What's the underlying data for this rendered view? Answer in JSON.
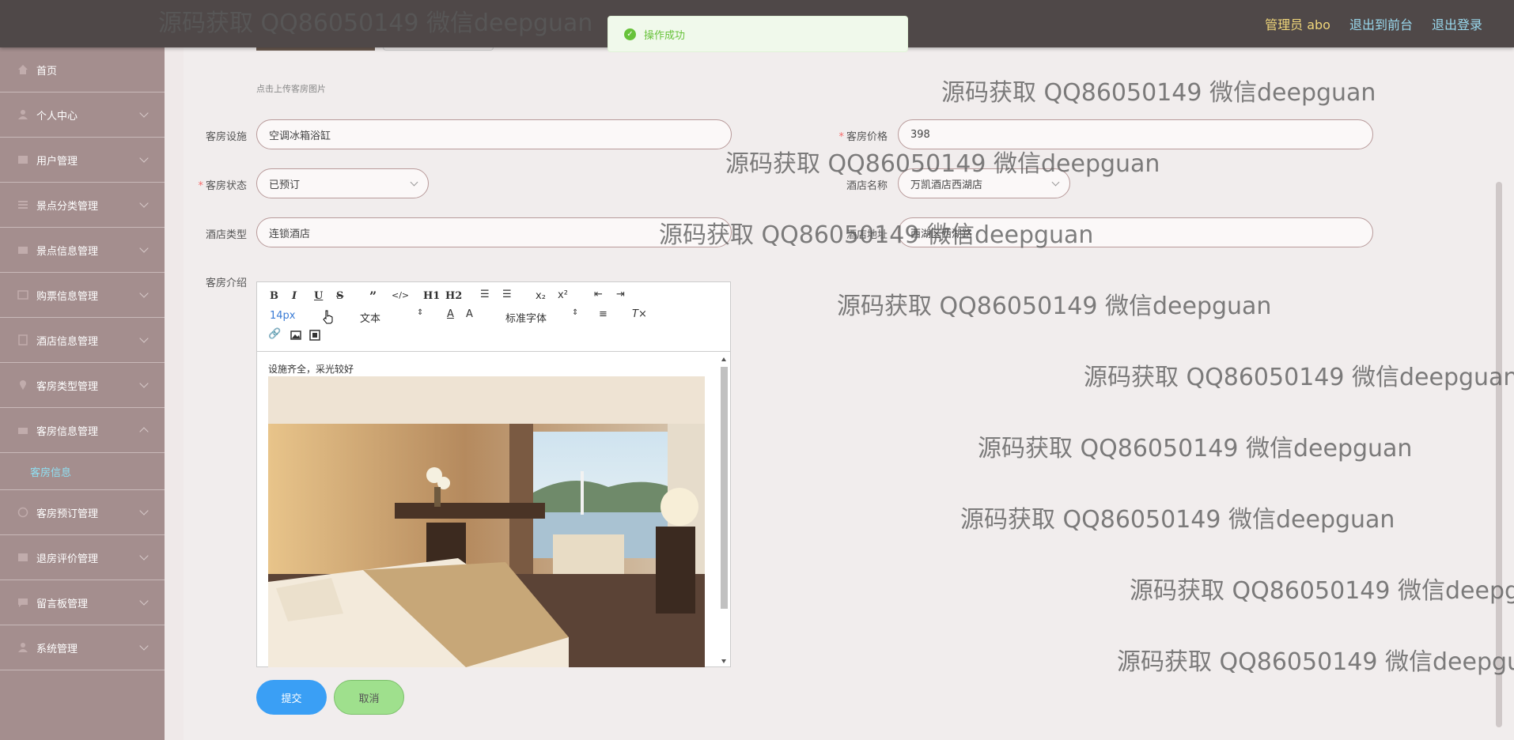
{
  "topbar": {
    "admin": "管理员 abo",
    "to_front": "退出到前台",
    "logout": "退出登录"
  },
  "sidebar": {
    "items": [
      {
        "label": "首页",
        "icon": "home-icon"
      },
      {
        "label": "个人中心",
        "icon": "user-icon"
      },
      {
        "label": "用户管理",
        "icon": "users-icon"
      },
      {
        "label": "景点分类管理",
        "icon": "list-icon"
      },
      {
        "label": "景点信息管理",
        "icon": "scenic-icon"
      },
      {
        "label": "购票信息管理",
        "icon": "ticket-icon"
      },
      {
        "label": "酒店信息管理",
        "icon": "hotel-icon"
      },
      {
        "label": "客房类型管理",
        "icon": "location-icon"
      },
      {
        "label": "客房信息管理",
        "icon": "room-icon"
      }
    ],
    "active_sub": "客房信息",
    "items_after": [
      {
        "label": "客房预订管理",
        "icon": "booking-icon"
      },
      {
        "label": "退房评价管理",
        "icon": "review-icon"
      },
      {
        "label": "留言板管理",
        "icon": "message-icon"
      },
      {
        "label": "系统管理",
        "icon": "system-icon"
      }
    ]
  },
  "form": {
    "upload_hint": "点击上传客房图片",
    "facility_label": "客房设施",
    "facility_value": "空调冰箱浴缸",
    "price_label": "客房价格",
    "price_value": "398",
    "status_label": "客房状态",
    "status_value": "已预订",
    "hotel_name_label": "酒店名称",
    "hotel_name_value": "万凯酒店西湖店",
    "hotel_type_label": "酒店类型",
    "hotel_type_value": "连锁酒店",
    "hotel_addr_label": "酒店地址",
    "hotel_addr_value": "西湖区西湖路",
    "intro_label": "客房介绍",
    "intro_text": "设施齐全，采光较好",
    "submit": "提交",
    "cancel": "取消"
  },
  "editor_toolbar": {
    "font_size": "14px",
    "text_type": "文本",
    "font_family": "标准字体",
    "h1": "H1",
    "h2": "H2"
  },
  "toast": {
    "message": "操作成功"
  },
  "watermark": "源码获取 QQ86050149 微信deepguan"
}
